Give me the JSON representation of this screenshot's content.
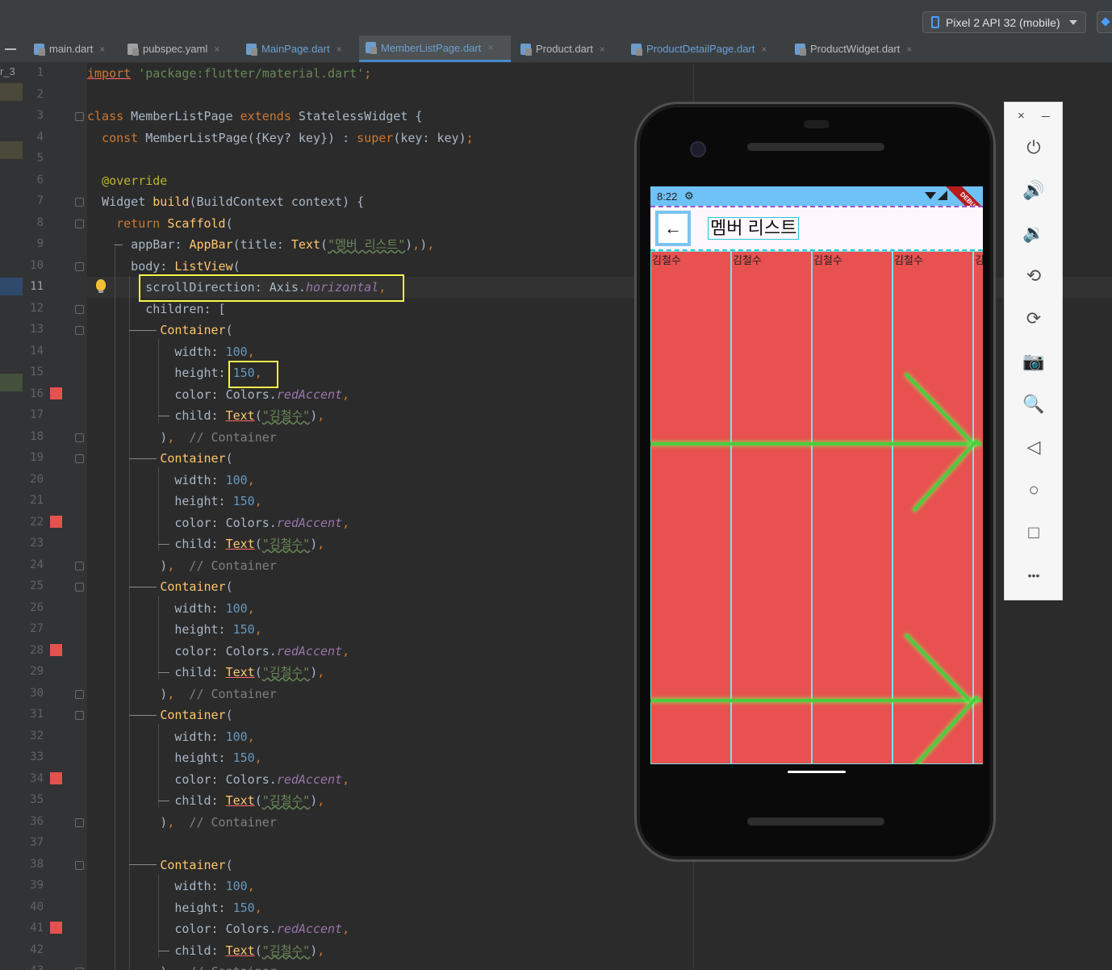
{
  "toolbar": {
    "device_selector": "Pixel 2 API 32 (mobile)"
  },
  "gutter_label": "r_3",
  "tabs": [
    {
      "label": "main.dart",
      "active": false
    },
    {
      "label": "pubspec.yaml",
      "active": false
    },
    {
      "label": "MainPage.dart",
      "active": false
    },
    {
      "label": "MemberListPage.dart",
      "active": true
    },
    {
      "label": "Product.dart",
      "active": false
    },
    {
      "label": "ProductDetailPage.dart",
      "active": false
    },
    {
      "label": "ProductWidget.dart",
      "active": false
    }
  ],
  "editor": {
    "current_line": 11,
    "line_numbers": [
      "1",
      "2",
      "3",
      "4",
      "5",
      "6",
      "7",
      "8",
      "9",
      "10",
      "11",
      "12",
      "13",
      "14",
      "15",
      "16",
      "17",
      "18",
      "19",
      "20",
      "21",
      "22",
      "23",
      "24",
      "25",
      "26",
      "27",
      "28",
      "29",
      "30",
      "31",
      "32",
      "33",
      "34",
      "35",
      "36",
      "37",
      "38",
      "39",
      "40",
      "41",
      "42",
      "43"
    ],
    "breakpoint_lines": [
      16,
      22,
      28,
      34,
      41
    ],
    "fold_lines": [
      3,
      7,
      8,
      10,
      12,
      13,
      18,
      19,
      24,
      25,
      30,
      31,
      36,
      38,
      43
    ],
    "lines": [
      {
        "n": 1,
        "segments": [
          {
            "t": "import",
            "c": "k u"
          },
          {
            "t": " ",
            "c": ""
          },
          {
            "t": "'package:flutter/material.dart'",
            "c": "s"
          },
          {
            "t": ";",
            "c": "k"
          }
        ]
      },
      {
        "n": 2,
        "segments": []
      },
      {
        "n": 3,
        "segments": [
          {
            "t": "class",
            "c": "k"
          },
          {
            "t": " MemberListPage ",
            "c": ""
          },
          {
            "t": "extends",
            "c": "k"
          },
          {
            "t": " StatelessWidget {",
            "c": ""
          }
        ]
      },
      {
        "n": 4,
        "segments": [
          {
            "t": "  ",
            "c": ""
          },
          {
            "t": "const",
            "c": "k"
          },
          {
            "t": " MemberListPage({Key? key}) : ",
            "c": ""
          },
          {
            "t": "super",
            "c": "k"
          },
          {
            "t": "(key: key)",
            "c": ""
          },
          {
            "t": ";",
            "c": "k"
          }
        ]
      },
      {
        "n": 5,
        "segments": []
      },
      {
        "n": 6,
        "segments": [
          {
            "t": "  ",
            "c": ""
          },
          {
            "t": "@override",
            "c": "a"
          }
        ]
      },
      {
        "n": 7,
        "segments": [
          {
            "t": "  Widget ",
            "c": ""
          },
          {
            "t": "build",
            "c": "f"
          },
          {
            "t": "(BuildContext context) {",
            "c": ""
          }
        ]
      },
      {
        "n": 8,
        "segments": [
          {
            "t": "    ",
            "c": ""
          },
          {
            "t": "return",
            "c": "k"
          },
          {
            "t": " ",
            "c": ""
          },
          {
            "t": "Scaffold",
            "c": "f"
          },
          {
            "t": "(",
            "c": ""
          }
        ]
      },
      {
        "n": 9,
        "segments": [
          {
            "t": "      appBar: ",
            "c": ""
          },
          {
            "t": "AppBar",
            "c": "f"
          },
          {
            "t": "(title: ",
            "c": ""
          },
          {
            "t": "Text",
            "c": "f"
          },
          {
            "t": "(",
            "c": ""
          },
          {
            "t": "\"멤버 리스트\"",
            "c": "s w"
          },
          {
            "t": ")",
            "c": ""
          },
          {
            "t": ",",
            "c": "k"
          },
          {
            "t": ")",
            "c": ""
          },
          {
            "t": ",",
            "c": "k"
          }
        ]
      },
      {
        "n": 10,
        "segments": [
          {
            "t": "      body: ",
            "c": ""
          },
          {
            "t": "ListView",
            "c": "f"
          },
          {
            "t": "(",
            "c": ""
          }
        ]
      },
      {
        "n": 11,
        "segments": [
          {
            "t": "        scrollDirection: Axis.",
            "c": ""
          },
          {
            "t": "horizontal",
            "c": "p"
          },
          {
            "t": ",",
            "c": "k"
          }
        ]
      },
      {
        "n": 12,
        "segments": [
          {
            "t": "        children: [",
            "c": ""
          }
        ]
      },
      {
        "n": 13,
        "segments": [
          {
            "t": "          ",
            "c": ""
          },
          {
            "t": "Container",
            "c": "f"
          },
          {
            "t": "(",
            "c": ""
          }
        ]
      },
      {
        "n": 14,
        "segments": [
          {
            "t": "            width: ",
            "c": ""
          },
          {
            "t": "100",
            "c": "n"
          },
          {
            "t": ",",
            "c": "k"
          }
        ]
      },
      {
        "n": 15,
        "segments": [
          {
            "t": "            height: ",
            "c": ""
          },
          {
            "t": "150",
            "c": "n"
          },
          {
            "t": ",",
            "c": "k"
          }
        ]
      },
      {
        "n": 16,
        "segments": [
          {
            "t": "            color: Colors.",
            "c": ""
          },
          {
            "t": "redAccent",
            "c": "p"
          },
          {
            "t": ",",
            "c": "k"
          }
        ]
      },
      {
        "n": 17,
        "segments": [
          {
            "t": "            child: ",
            "c": ""
          },
          {
            "t": "Text",
            "c": "f u"
          },
          {
            "t": "(",
            "c": ""
          },
          {
            "t": "\"김철수\"",
            "c": "s w"
          },
          {
            "t": ")",
            "c": ""
          },
          {
            "t": ",",
            "c": "k"
          }
        ]
      },
      {
        "n": 18,
        "segments": [
          {
            "t": "          )",
            "c": ""
          },
          {
            "t": ",",
            "c": "k"
          },
          {
            "t": "  // Container",
            "c": "c"
          }
        ]
      },
      {
        "n": 19,
        "segments": [
          {
            "t": "          ",
            "c": ""
          },
          {
            "t": "Container",
            "c": "f"
          },
          {
            "t": "(",
            "c": ""
          }
        ]
      },
      {
        "n": 20,
        "segments": [
          {
            "t": "            width: ",
            "c": ""
          },
          {
            "t": "100",
            "c": "n"
          },
          {
            "t": ",",
            "c": "k"
          }
        ]
      },
      {
        "n": 21,
        "segments": [
          {
            "t": "            height: ",
            "c": ""
          },
          {
            "t": "150",
            "c": "n"
          },
          {
            "t": ",",
            "c": "k"
          }
        ]
      },
      {
        "n": 22,
        "segments": [
          {
            "t": "            color: Colors.",
            "c": ""
          },
          {
            "t": "redAccent",
            "c": "p"
          },
          {
            "t": ",",
            "c": "k"
          }
        ]
      },
      {
        "n": 23,
        "segments": [
          {
            "t": "            child: ",
            "c": ""
          },
          {
            "t": "Text",
            "c": "f u"
          },
          {
            "t": "(",
            "c": ""
          },
          {
            "t": "\"김철수\"",
            "c": "s w"
          },
          {
            "t": ")",
            "c": ""
          },
          {
            "t": ",",
            "c": "k"
          }
        ]
      },
      {
        "n": 24,
        "segments": [
          {
            "t": "          )",
            "c": ""
          },
          {
            "t": ",",
            "c": "k"
          },
          {
            "t": "  // Container",
            "c": "c"
          }
        ]
      },
      {
        "n": 25,
        "segments": [
          {
            "t": "          ",
            "c": ""
          },
          {
            "t": "Container",
            "c": "f"
          },
          {
            "t": "(",
            "c": ""
          }
        ]
      },
      {
        "n": 26,
        "segments": [
          {
            "t": "            width: ",
            "c": ""
          },
          {
            "t": "100",
            "c": "n"
          },
          {
            "t": ",",
            "c": "k"
          }
        ]
      },
      {
        "n": 27,
        "segments": [
          {
            "t": "            height: ",
            "c": ""
          },
          {
            "t": "150",
            "c": "n"
          },
          {
            "t": ",",
            "c": "k"
          }
        ]
      },
      {
        "n": 28,
        "segments": [
          {
            "t": "            color: Colors.",
            "c": ""
          },
          {
            "t": "redAccent",
            "c": "p"
          },
          {
            "t": ",",
            "c": "k"
          }
        ]
      },
      {
        "n": 29,
        "segments": [
          {
            "t": "            child: ",
            "c": ""
          },
          {
            "t": "Text",
            "c": "f u"
          },
          {
            "t": "(",
            "c": ""
          },
          {
            "t": "\"김철수\"",
            "c": "s w"
          },
          {
            "t": ")",
            "c": ""
          },
          {
            "t": ",",
            "c": "k"
          }
        ]
      },
      {
        "n": 30,
        "segments": [
          {
            "t": "          )",
            "c": ""
          },
          {
            "t": ",",
            "c": "k"
          },
          {
            "t": "  // Container",
            "c": "c"
          }
        ]
      },
      {
        "n": 31,
        "segments": [
          {
            "t": "          ",
            "c": ""
          },
          {
            "t": "Container",
            "c": "f"
          },
          {
            "t": "(",
            "c": ""
          }
        ]
      },
      {
        "n": 32,
        "segments": [
          {
            "t": "            width: ",
            "c": ""
          },
          {
            "t": "100",
            "c": "n"
          },
          {
            "t": ",",
            "c": "k"
          }
        ]
      },
      {
        "n": 33,
        "segments": [
          {
            "t": "            height: ",
            "c": ""
          },
          {
            "t": "150",
            "c": "n"
          },
          {
            "t": ",",
            "c": "k"
          }
        ]
      },
      {
        "n": 34,
        "segments": [
          {
            "t": "            color: Colors.",
            "c": ""
          },
          {
            "t": "redAccent",
            "c": "p"
          },
          {
            "t": ",",
            "c": "k"
          }
        ]
      },
      {
        "n": 35,
        "segments": [
          {
            "t": "            child: ",
            "c": ""
          },
          {
            "t": "Text",
            "c": "f u"
          },
          {
            "t": "(",
            "c": ""
          },
          {
            "t": "\"김철수\"",
            "c": "s w"
          },
          {
            "t": ")",
            "c": ""
          },
          {
            "t": ",",
            "c": "k"
          }
        ]
      },
      {
        "n": 36,
        "segments": [
          {
            "t": "          )",
            "c": ""
          },
          {
            "t": ",",
            "c": "k"
          },
          {
            "t": "  // Container",
            "c": "c"
          }
        ]
      },
      {
        "n": 37,
        "segments": []
      },
      {
        "n": 38,
        "segments": [
          {
            "t": "          ",
            "c": ""
          },
          {
            "t": "Container",
            "c": "f"
          },
          {
            "t": "(",
            "c": ""
          }
        ]
      },
      {
        "n": 39,
        "segments": [
          {
            "t": "            width: ",
            "c": ""
          },
          {
            "t": "100",
            "c": "n"
          },
          {
            "t": ",",
            "c": "k"
          }
        ]
      },
      {
        "n": 40,
        "segments": [
          {
            "t": "            height: ",
            "c": ""
          },
          {
            "t": "150",
            "c": "n"
          },
          {
            "t": ",",
            "c": "k"
          }
        ]
      },
      {
        "n": 41,
        "segments": [
          {
            "t": "            color: Colors.",
            "c": ""
          },
          {
            "t": "redAccent",
            "c": "p"
          },
          {
            "t": ",",
            "c": "k"
          }
        ]
      },
      {
        "n": 42,
        "segments": [
          {
            "t": "            child: ",
            "c": ""
          },
          {
            "t": "Text",
            "c": "f u"
          },
          {
            "t": "(",
            "c": ""
          },
          {
            "t": "\"김철수\"",
            "c": "s w"
          },
          {
            "t": ")",
            "c": ""
          },
          {
            "t": ",",
            "c": "k"
          }
        ]
      },
      {
        "n": 43,
        "segments": [
          {
            "t": "          )",
            "c": ""
          },
          {
            "t": ",",
            "c": "k"
          },
          {
            "t": "  // Container",
            "c": "c"
          }
        ]
      }
    ]
  },
  "emulator": {
    "status_time": "8:22",
    "status_gear": "⚙",
    "debug_banner": "DEBUG",
    "back_icon": "←",
    "appbar_title": "멤버 리스트",
    "list_items": [
      "김철수",
      "김철수",
      "김철수",
      "김철수",
      "김철수"
    ]
  },
  "emulator_toolbar": {
    "close": "×",
    "buttons": [
      {
        "name": "power-icon",
        "glyph": "⏻"
      },
      {
        "name": "volume-up-icon",
        "glyph": "🔊"
      },
      {
        "name": "volume-down-icon",
        "glyph": "🔉"
      },
      {
        "name": "rotate-left-icon",
        "glyph": "⟲"
      },
      {
        "name": "rotate-right-icon",
        "glyph": "⟳"
      },
      {
        "name": "camera-icon",
        "glyph": "📷"
      },
      {
        "name": "zoom-icon",
        "glyph": "🔍"
      },
      {
        "name": "back-icon",
        "glyph": "◁"
      },
      {
        "name": "home-icon",
        "glyph": "○"
      },
      {
        "name": "overview-icon",
        "glyph": "□"
      },
      {
        "name": "more-icon",
        "glyph": "•••"
      }
    ]
  },
  "colors": {
    "editor_bg": "#2b2b2b",
    "keyword": "#cc7832",
    "string": "#6a8759",
    "number": "#6897bb",
    "function": "#ffc66d",
    "highlight_box": "#f7f74a",
    "container_red": "#e8514f"
  }
}
